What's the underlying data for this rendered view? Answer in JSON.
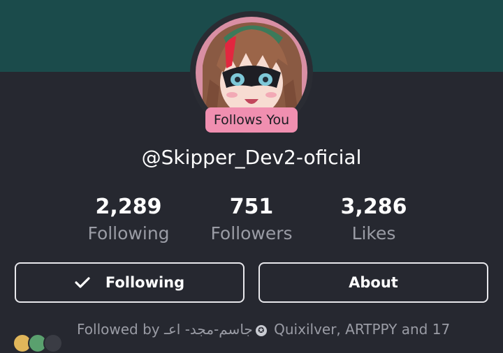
{
  "profile": {
    "badge": "Follows You",
    "username": "@Skipper_Dev2-oficial"
  },
  "stats": [
    {
      "value": "2,289",
      "label": "Following"
    },
    {
      "value": "751",
      "label": "Followers"
    },
    {
      "value": "3,286",
      "label": "Likes"
    }
  ],
  "actions": {
    "following_label": "Following",
    "about_label": "About"
  },
  "followed_by": {
    "prefix": "Followed by",
    "first_name": "جاسم-مجد- اعـ",
    "rest": "Quixilver, ARTPPY and 17"
  },
  "icons": {
    "check": "check-icon",
    "star": "star-badge-icon"
  },
  "colors": {
    "banner": "#1b4b4b",
    "background": "#262830",
    "badge": "#f08fb0",
    "secondary_text": "#9a9ca5"
  }
}
